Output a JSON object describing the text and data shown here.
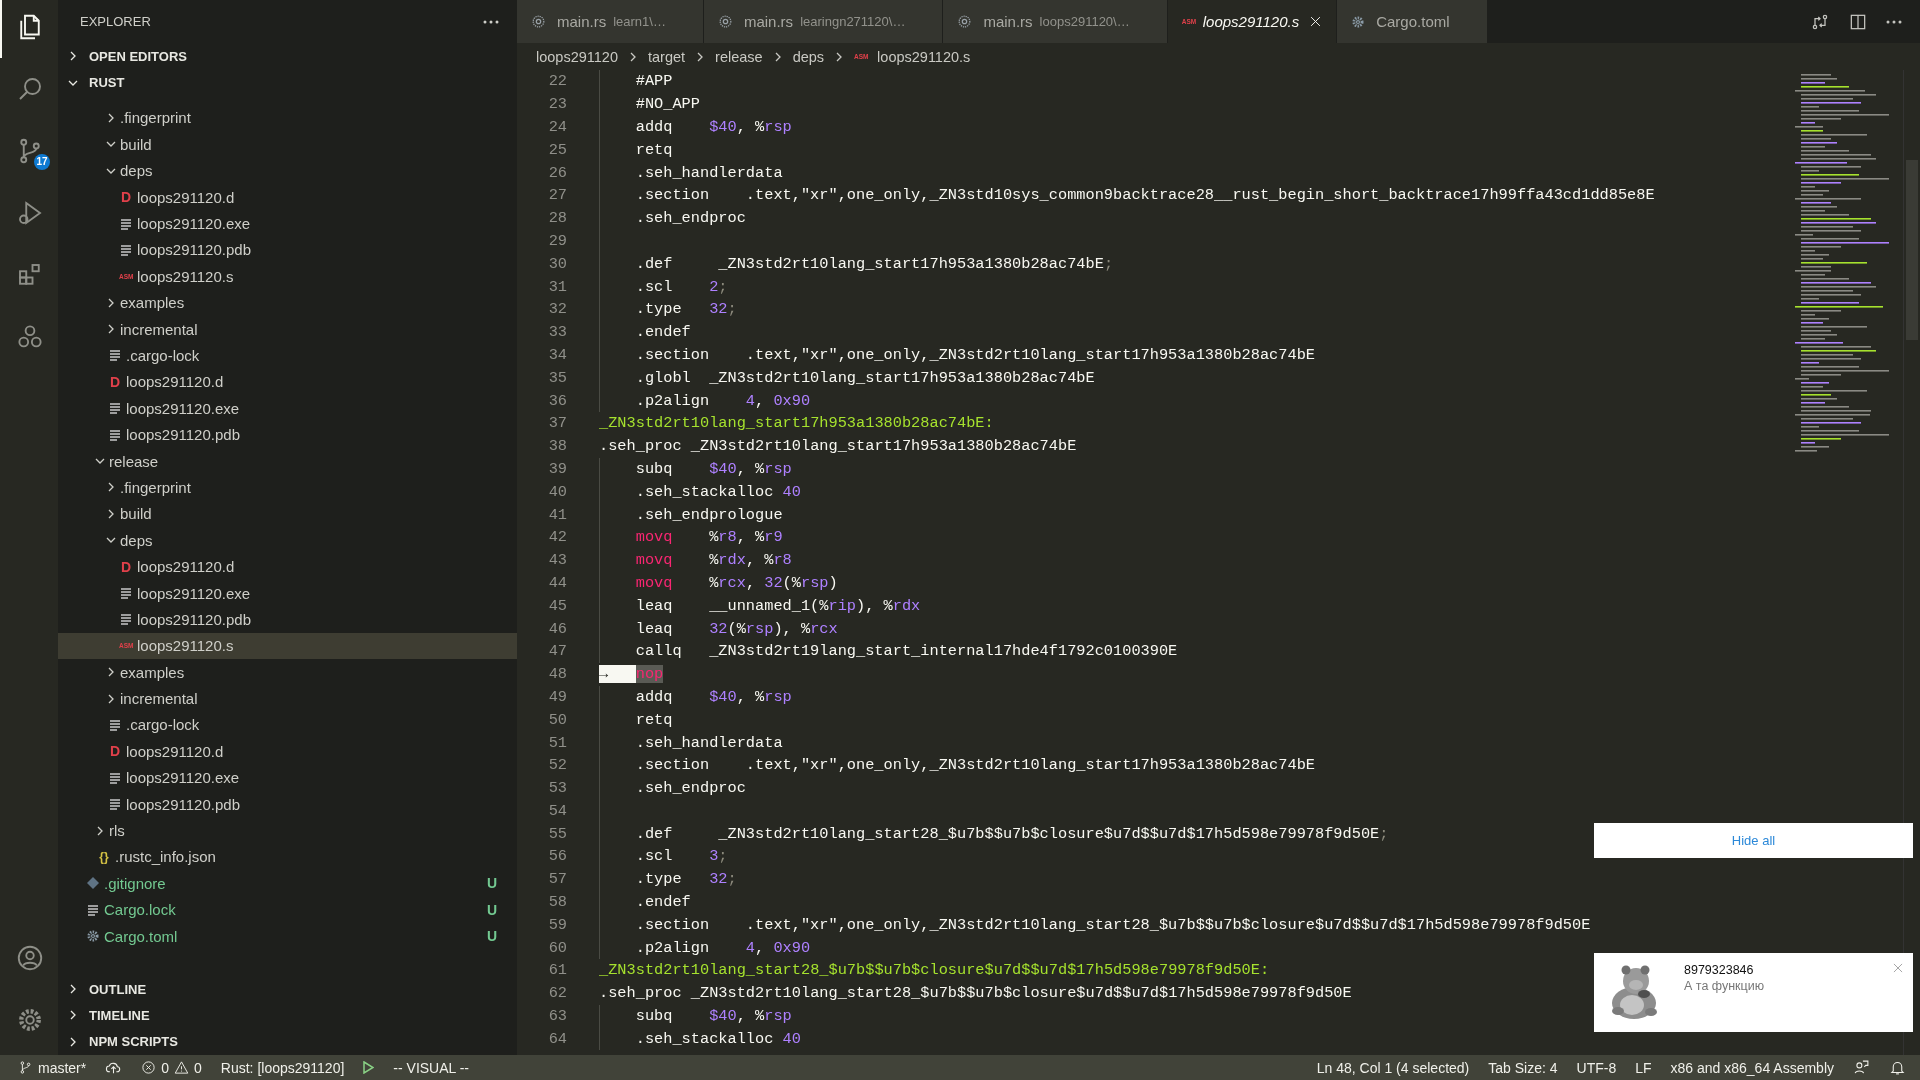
{
  "activity_bar": {
    "top": [
      {
        "selected": true
      },
      {
        "selected": false
      },
      {
        "selected": false,
        "badge": "17"
      },
      {
        "selected": false
      },
      {
        "selected": false
      },
      {
        "selected": false
      }
    ],
    "bottom": [
      {
        "selected": false
      },
      {
        "selected": false
      }
    ]
  },
  "sidebar": {
    "title": "EXPLORER",
    "sections": [
      {
        "label": "OPEN EDITORS",
        "expanded": false
      },
      {
        "label": "RUST",
        "expanded": true,
        "tree": [
          {
            "children": [
              {
                "children": [
                  {
                    "kind": "folder",
                    "label": ".fingerprint",
                    "expanded": false,
                    "selected": false
                  },
                  {
                    "kind": "folder",
                    "label": "build",
                    "expanded": true,
                    "selected": false
                  },
                  {
                    "kind": "folder",
                    "label": "deps",
                    "expanded": true,
                    "selected": false,
                    "children": [
                      {
                        "kind": "d_file",
                        "label": "loops291120.d",
                        "glyph": "D",
                        "selected": false
                      },
                      {
                        "kind": "text_file",
                        "label": "loops291120.exe",
                        "selected": false
                      },
                      {
                        "kind": "text_file",
                        "label": "loops291120.pdb",
                        "selected": false
                      },
                      {
                        "kind": "asm_file",
                        "label": "loops291120.s",
                        "glyph": "ASM",
                        "selected": false
                      }
                    ]
                  },
                  {
                    "kind": "folder",
                    "label": "examples",
                    "expanded": false,
                    "selected": false
                  },
                  {
                    "kind": "folder",
                    "label": "incremental",
                    "expanded": false,
                    "selected": false
                  },
                  {
                    "kind": "text_file",
                    "label": ".cargo-lock",
                    "selected": false
                  },
                  {
                    "kind": "d_file",
                    "label": "loops291120.d",
                    "glyph": "D",
                    "selected": false
                  },
                  {
                    "kind": "text_file",
                    "label": "loops291120.exe",
                    "selected": false
                  },
                  {
                    "kind": "text_file",
                    "label": "loops291120.pdb",
                    "selected": false
                  }
                ]
              },
              {
                "kind": "folder",
                "label": "release",
                "expanded": true,
                "selected": false,
                "children": [
                  {
                    "kind": "folder",
                    "label": ".fingerprint",
                    "expanded": false,
                    "selected": false
                  },
                  {
                    "kind": "folder",
                    "label": "build",
                    "expanded": false,
                    "selected": false
                  },
                  {
                    "kind": "folder",
                    "label": "deps",
                    "expanded": true,
                    "selected": false,
                    "children": [
                      {
                        "kind": "d_file",
                        "label": "loops291120.d",
                        "glyph": "D",
                        "selected": false
                      },
                      {
                        "kind": "text_file",
                        "label": "loops291120.exe",
                        "selected": false
                      },
                      {
                        "kind": "text_file",
                        "label": "loops291120.pdb",
                        "selected": false
                      },
                      {
                        "kind": "asm_file",
                        "label": "loops291120.s",
                        "glyph": "ASM",
                        "selected": true
                      }
                    ]
                  },
                  {
                    "kind": "folder",
                    "label": "examples",
                    "expanded": false,
                    "selected": false
                  },
                  {
                    "kind": "folder",
                    "label": "incremental",
                    "expanded": false,
                    "selected": false
                  },
                  {
                    "kind": "text_file",
                    "label": ".cargo-lock",
                    "selected": false
                  },
                  {
                    "kind": "d_file",
                    "label": "loops291120.d",
                    "glyph": "D",
                    "selected": false
                  },
                  {
                    "kind": "text_file",
                    "label": "loops291120.exe",
                    "selected": false
                  },
                  {
                    "kind": "text_file",
                    "label": "loops291120.pdb",
                    "selected": false
                  }
                ]
              },
              {
                "kind": "folder",
                "label": "rls",
                "expanded": false,
                "selected": false
              },
              {
                "kind": "json_file",
                "label": ".rustc_info.json",
                "glyph": "{}",
                "selected": false
              }
            ]
          },
          {
            "kind": "git_file",
            "label": ".gitignore",
            "badge": "U",
            "selected": false
          },
          {
            "kind": "text_file",
            "label": "Cargo.lock",
            "badge": "U",
            "selected": false
          },
          {
            "kind": "config_file",
            "label": "Cargo.toml",
            "badge": "U",
            "selected": false
          }
        ]
      },
      {
        "label": "OUTLINE",
        "expanded": false
      },
      {
        "label": "TIMELINE",
        "expanded": false
      },
      {
        "label": "NPM SCRIPTS",
        "expanded": false
      }
    ]
  },
  "tabs": [
    {
      "label": "main.rs",
      "description": "learn1\\…",
      "kind": "rust_file",
      "selected": false,
      "preview": false
    },
    {
      "label": "main.rs",
      "description": "learingn271120\\…",
      "kind": "rust_file",
      "selected": false,
      "preview": false
    },
    {
      "label": "main.rs",
      "description": "loops291120\\…",
      "kind": "rust_file",
      "selected": false,
      "preview": false
    },
    {
      "label": "loops291120.s",
      "kind": "asm_file",
      "glyph": "ASM",
      "selected": true,
      "preview": true
    },
    {
      "label": "Cargo.toml",
      "kind": "config_file",
      "selected": false,
      "preview": false
    }
  ],
  "breadcrumbs": [
    {
      "label": "loops291120"
    },
    {
      "label": "target"
    },
    {
      "label": "release"
    },
    {
      "label": "deps"
    },
    {
      "label": "loops291120.s",
      "glyph": "ASM"
    }
  ],
  "editor": {
    "lines": [
      {
        "number": "22",
        "indented": true,
        "tokens": [
          {
            "text": "#APP",
            "kind": "plain"
          }
        ]
      },
      {
        "number": "23",
        "indented": true,
        "tokens": [
          {
            "text": "#NO_APP",
            "kind": "plain"
          }
        ]
      },
      {
        "number": "24",
        "indented": true,
        "tokens": [
          {
            "text": "addq    ",
            "kind": "plain"
          },
          {
            "text": "$40",
            "kind": "number"
          },
          {
            "text": ", %",
            "kind": "plain"
          },
          {
            "text": "rsp",
            "kind": "number"
          }
        ]
      },
      {
        "number": "25",
        "indented": true,
        "tokens": [
          {
            "text": "retq",
            "kind": "plain"
          }
        ]
      },
      {
        "number": "26",
        "indented": true,
        "tokens": [
          {
            "text": ".seh_handlerdata",
            "kind": "plain"
          }
        ]
      },
      {
        "number": "27",
        "indented": true,
        "tokens": [
          {
            "text": ".section    .text,\"xr\",one_only,_ZN3std10sys_common9backtrace28__rust_begin_short_backtrace17h99ffa43cd1dd85e8E",
            "kind": "plain"
          }
        ]
      },
      {
        "number": "28",
        "indented": true,
        "tokens": [
          {
            "text": ".seh_endproc",
            "kind": "plain"
          }
        ]
      },
      {
        "number": "29",
        "indented": true
      },
      {
        "number": "30",
        "indented": true,
        "tokens": [
          {
            "text": ".def     _ZN3std2rt10lang_start17h953a1380b28ac74bE",
            "kind": "plain"
          },
          {
            "text": ";",
            "kind": "punct"
          }
        ]
      },
      {
        "number": "31",
        "indented": true,
        "tokens": [
          {
            "text": ".scl    ",
            "kind": "plain"
          },
          {
            "text": "2",
            "kind": "number"
          },
          {
            "text": ";",
            "kind": "punct"
          }
        ]
      },
      {
        "number": "32",
        "indented": true,
        "tokens": [
          {
            "text": ".type   ",
            "kind": "plain"
          },
          {
            "text": "32",
            "kind": "number"
          },
          {
            "text": ";",
            "kind": "punct"
          }
        ]
      },
      {
        "number": "33",
        "indented": true,
        "tokens": [
          {
            "text": ".endef",
            "kind": "plain"
          }
        ]
      },
      {
        "number": "34",
        "indented": true,
        "tokens": [
          {
            "text": ".section    .text,\"xr\",one_only,_ZN3std2rt10lang_start17h953a1380b28ac74bE",
            "kind": "plain"
          }
        ]
      },
      {
        "number": "35",
        "indented": true,
        "tokens": [
          {
            "text": ".globl  _ZN3std2rt10lang_start17h953a1380b28ac74bE",
            "kind": "plain"
          }
        ]
      },
      {
        "number": "36",
        "indented": true,
        "tokens": [
          {
            "text": ".p2align    ",
            "kind": "plain"
          },
          {
            "text": "4",
            "kind": "number"
          },
          {
            "text": ", ",
            "kind": "plain"
          },
          {
            "text": "0x90",
            "kind": "number"
          }
        ]
      },
      {
        "number": "37",
        "indented": false,
        "tokens": [
          {
            "text": "_ZN3std2rt10lang_start17h953a1380b28ac74bE:",
            "kind": "label"
          }
        ]
      },
      {
        "number": "38",
        "indented": false,
        "tokens": [
          {
            "text": ".seh_proc _ZN3std2rt10lang_start17h953a1380b28ac74bE",
            "kind": "plain"
          }
        ]
      },
      {
        "number": "39",
        "indented": true,
        "tokens": [
          {
            "text": "subq    ",
            "kind": "plain"
          },
          {
            "text": "$40",
            "kind": "number"
          },
          {
            "text": ", %",
            "kind": "plain"
          },
          {
            "text": "rsp",
            "kind": "number"
          }
        ]
      },
      {
        "number": "40",
        "indented": true,
        "tokens": [
          {
            "text": ".seh_stackalloc ",
            "kind": "plain"
          },
          {
            "text": "40",
            "kind": "number"
          }
        ]
      },
      {
        "number": "41",
        "indented": true,
        "tokens": [
          {
            "text": ".seh_endprologue",
            "kind": "plain"
          }
        ]
      },
      {
        "number": "42",
        "indented": true,
        "tokens": [
          {
            "text": "movq",
            "kind": "keyword"
          },
          {
            "text": "    %",
            "kind": "plain"
          },
          {
            "text": "r8",
            "kind": "number"
          },
          {
            "text": ", %",
            "kind": "plain"
          },
          {
            "text": "r9",
            "kind": "number"
          }
        ]
      },
      {
        "number": "43",
        "indented": true,
        "tokens": [
          {
            "text": "movq",
            "kind": "keyword"
          },
          {
            "text": "    %",
            "kind": "plain"
          },
          {
            "text": "rdx",
            "kind": "number"
          },
          {
            "text": ", %",
            "kind": "plain"
          },
          {
            "text": "r8",
            "kind": "number"
          }
        ]
      },
      {
        "number": "44",
        "indented": true,
        "tokens": [
          {
            "text": "movq",
            "kind": "keyword"
          },
          {
            "text": "    %",
            "kind": "plain"
          },
          {
            "text": "rcx",
            "kind": "number"
          },
          {
            "text": ", ",
            "kind": "plain"
          },
          {
            "text": "32",
            "kind": "number"
          },
          {
            "text": "(%",
            "kind": "plain"
          },
          {
            "text": "rsp",
            "kind": "number"
          },
          {
            "text": ")",
            "kind": "plain"
          }
        ]
      },
      {
        "number": "45",
        "indented": true,
        "tokens": [
          {
            "text": "leaq    __unnamed_1(%",
            "kind": "plain"
          },
          {
            "text": "rip",
            "kind": "number"
          },
          {
            "text": "), %",
            "kind": "plain"
          },
          {
            "text": "rdx",
            "kind": "number"
          }
        ]
      },
      {
        "number": "46",
        "indented": true,
        "tokens": [
          {
            "text": "leaq    ",
            "kind": "plain"
          },
          {
            "text": "32",
            "kind": "number"
          },
          {
            "text": "(%",
            "kind": "plain"
          },
          {
            "text": "rsp",
            "kind": "number"
          },
          {
            "text": "), %",
            "kind": "plain"
          },
          {
            "text": "rcx",
            "kind": "number"
          }
        ]
      },
      {
        "number": "47",
        "indented": true,
        "tokens": [
          {
            "text": "callq   _ZN3std2rt19lang_start_internal17hde4f1792c0100390E",
            "kind": "plain"
          }
        ]
      },
      {
        "number": "48",
        "indented": false,
        "tokens": [
          {
            "text": "→",
            "kind": "selected_tab"
          },
          {
            "text": "nop",
            "kind": "selected_keyword"
          }
        ]
      },
      {
        "number": "49",
        "indented": true,
        "tokens": [
          {
            "text": "addq    ",
            "kind": "plain"
          },
          {
            "text": "$40",
            "kind": "number"
          },
          {
            "text": ", %",
            "kind": "plain"
          },
          {
            "text": "rsp",
            "kind": "number"
          }
        ]
      },
      {
        "number": "50",
        "indented": true,
        "tokens": [
          {
            "text": "retq",
            "kind": "plain"
          }
        ]
      },
      {
        "number": "51",
        "indented": true,
        "tokens": [
          {
            "text": ".seh_handlerdata",
            "kind": "plain"
          }
        ]
      },
      {
        "number": "52",
        "indented": true,
        "tokens": [
          {
            "text": ".section    .text,\"xr\",one_only,_ZN3std2rt10lang_start17h953a1380b28ac74bE",
            "kind": "plain"
          }
        ]
      },
      {
        "number": "53",
        "indented": true,
        "tokens": [
          {
            "text": ".seh_endproc",
            "kind": "plain"
          }
        ]
      },
      {
        "number": "54",
        "indented": true
      },
      {
        "number": "55",
        "indented": true,
        "tokens": [
          {
            "text": ".def     _ZN3std2rt10lang_start28_$u7b$$u7b$closure$u7d$$u7d$17h5d598e79978f9d50E",
            "kind": "plain"
          },
          {
            "text": ";",
            "kind": "punct"
          }
        ]
      },
      {
        "number": "56",
        "indented": true,
        "tokens": [
          {
            "text": ".scl    ",
            "kind": "plain"
          },
          {
            "text": "3",
            "kind": "number"
          },
          {
            "text": ";",
            "kind": "punct"
          }
        ]
      },
      {
        "number": "57",
        "indented": true,
        "tokens": [
          {
            "text": ".type   ",
            "kind": "plain"
          },
          {
            "text": "32",
            "kind": "number"
          },
          {
            "text": ";",
            "kind": "punct"
          }
        ]
      },
      {
        "number": "58",
        "indented": true,
        "tokens": [
          {
            "text": ".endef",
            "kind": "plain"
          }
        ]
      },
      {
        "number": "59",
        "indented": true,
        "tokens": [
          {
            "text": ".section    .text,\"xr\",one_only,_ZN3std2rt10lang_start28_$u7b$$u7b$closure$u7d$$u7d$17h5d598e79978f9d50E",
            "kind": "plain"
          }
        ]
      },
      {
        "number": "60",
        "indented": true,
        "tokens": [
          {
            "text": ".p2align    ",
            "kind": "plain"
          },
          {
            "text": "4",
            "kind": "number"
          },
          {
            "text": ", ",
            "kind": "plain"
          },
          {
            "text": "0x90",
            "kind": "number"
          }
        ]
      },
      {
        "number": "61",
        "indented": false,
        "tokens": [
          {
            "text": "_ZN3std2rt10lang_start28_$u7b$$u7b$closure$u7d$$u7d$17h5d598e79978f9d50E:",
            "kind": "label"
          }
        ]
      },
      {
        "number": "62",
        "indented": false,
        "tokens": [
          {
            "text": ".seh_proc _ZN3std2rt10lang_start28_$u7b$$u7b$closure$u7d$$u7d$17h5d598e79978f9d50E",
            "kind": "plain"
          }
        ]
      },
      {
        "number": "63",
        "indented": true,
        "tokens": [
          {
            "text": "subq    ",
            "kind": "plain"
          },
          {
            "text": "$40",
            "kind": "number"
          },
          {
            "text": ", %",
            "kind": "plain"
          },
          {
            "text": "rsp",
            "kind": "number"
          }
        ]
      },
      {
        "number": "64",
        "indented": true,
        "tokens": [
          {
            "text": ".seh_stackalloc ",
            "kind": "plain"
          },
          {
            "text": "40",
            "kind": "number"
          }
        ]
      }
    ]
  },
  "notifications": {
    "hide_all": "Hide all",
    "toast": {
      "title": "8979323846",
      "message": "А та функцию"
    }
  },
  "status_bar": {
    "left": [
      {
        "kind": "branch",
        "text": "master*"
      },
      {
        "kind": "sync"
      },
      {
        "kind": "problems",
        "errors": "0",
        "warnings": "0"
      },
      {
        "kind": "text",
        "text": "Rust: [loops291120]"
      },
      {
        "kind": "run"
      },
      {
        "kind": "text",
        "text": "-- VISUAL --"
      }
    ],
    "right": [
      {
        "kind": "text",
        "text": "Ln 48, Col 1 (4 selected)"
      },
      {
        "kind": "text",
        "text": "Tab Size: 4"
      },
      {
        "kind": "text",
        "text": "UTF-8"
      },
      {
        "kind": "text",
        "text": "LF"
      },
      {
        "kind": "text",
        "text": "x86 and x86_64 Assembly"
      },
      {
        "kind": "feedback"
      },
      {
        "kind": "bell"
      }
    ]
  }
}
